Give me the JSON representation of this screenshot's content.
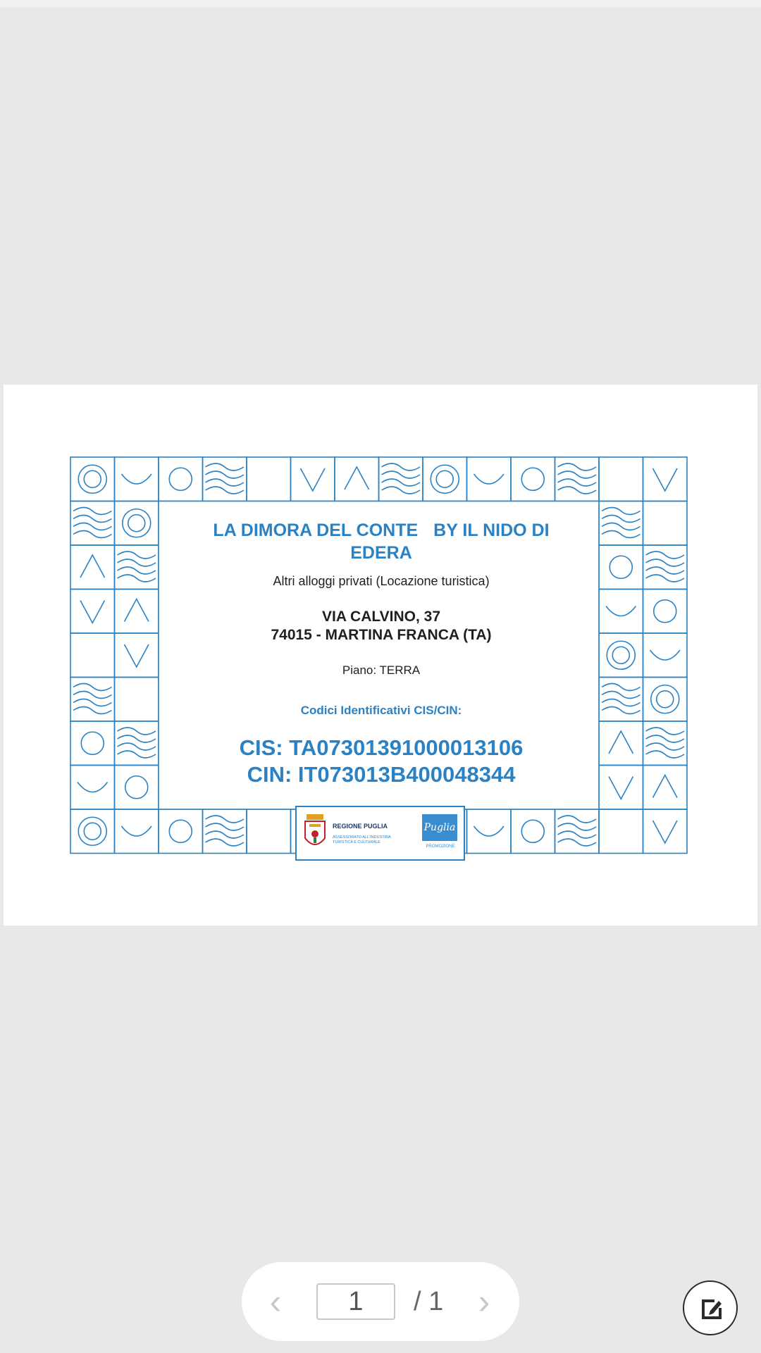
{
  "document": {
    "title_part1": "LA DIMORA DEL CONTE",
    "title_part2": "BY IL NIDO DI",
    "title_part3": "EDERA",
    "subtitle": "Altri alloggi privati (Locazione turistica)",
    "address_line1": "VIA CALVINO, 37",
    "address_line2": "74015 - MARTINA FRANCA (TA)",
    "floor": "Piano: TERRA",
    "codes_label": "Codici Identificativi CIS/CIN:",
    "cis": "CIS: TA07301391000013106",
    "cin": "CIN: IT073013B400048344",
    "logo_regione_name": "REGIONE PUGLIA",
    "logo_regione_sub": "ASSESSORATO ALL'INDUSTRIA TURISTICA E CULTURALE",
    "logo_puglia_mark": "Puglia",
    "logo_puglia_sub": "PROMOZIONE"
  },
  "pager": {
    "current_page": "1",
    "total": "/ 1",
    "prev_icon": "chevron-left-icon",
    "next_icon": "chevron-right-icon"
  },
  "fab": {
    "icon": "edit-pen-icon"
  },
  "colors": {
    "accent": "#2a82c4",
    "background": "#e8e8e8"
  }
}
